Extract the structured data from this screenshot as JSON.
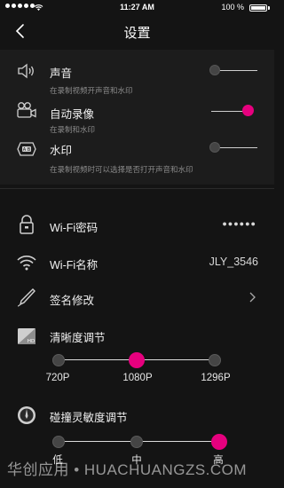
{
  "status_bar": {
    "time": "11:27 AM",
    "battery": "100 %"
  },
  "header": {
    "title": "设置"
  },
  "sound_section": {
    "items": [
      {
        "label": "声音",
        "sub": "在录制视频开声音和水印",
        "enabled": false
      },
      {
        "label": "自动录像",
        "sub": "在录制和水印",
        "enabled": true
      },
      {
        "label": "水印",
        "sub": "在录制视频时可以选择是否打开声音和水印",
        "enabled": false
      }
    ]
  },
  "wifi_password": {
    "label": "Wi-Fi密码",
    "value": "●●●●●●"
  },
  "wifi_name": {
    "label": "Wi-Fi名称",
    "value": "JLY_3546"
  },
  "signature": {
    "label": "签名修改"
  },
  "resolution": {
    "label": "清晰度调节",
    "options": [
      "720P",
      "1080P",
      "1296P"
    ],
    "selected_index": 1
  },
  "sensitivity": {
    "label": "碰撞灵敏度调节",
    "options": [
      "低",
      "中",
      "高"
    ],
    "selected_index": 2
  },
  "watermark_text": "华创应用 • HUACHUANGZS.COM",
  "colors": {
    "accent": "#e6007e",
    "background": "#141414",
    "section": "#1c1c1c"
  }
}
